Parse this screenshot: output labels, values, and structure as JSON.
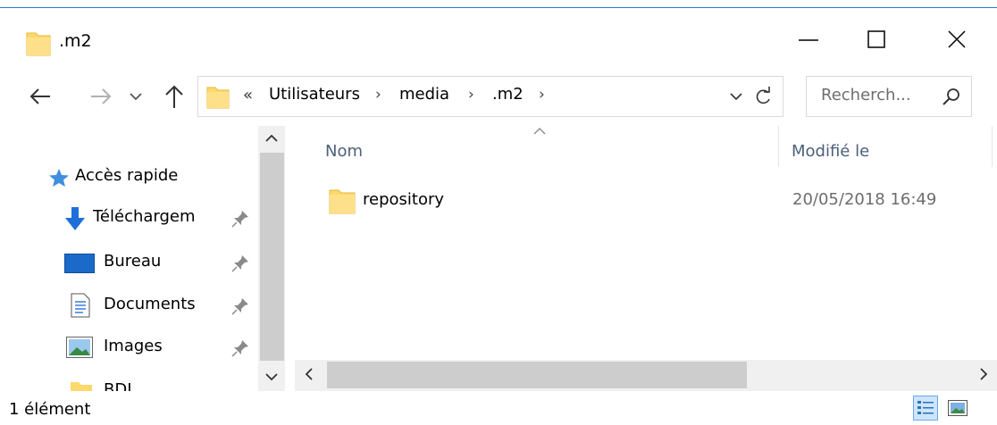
{
  "window": {
    "title": ".m2",
    "minimize_glyph": "—",
    "maximize_glyph": "☐",
    "close_glyph": "✕"
  },
  "address": {
    "overflow": "«",
    "crumbs": [
      "Utilisateurs",
      "media",
      ".m2"
    ],
    "separator": "›"
  },
  "search": {
    "placeholder": "Recherch..."
  },
  "nav_pane": {
    "items": [
      {
        "label": "Accès rapide",
        "icon": "star-icon"
      },
      {
        "label": "Téléchargem",
        "icon": "download-arrow-icon",
        "pinned": true
      },
      {
        "label": "Bureau",
        "icon": "desktop-icon",
        "pinned": true
      },
      {
        "label": "Documents",
        "icon": "document-icon",
        "pinned": true
      },
      {
        "label": "Images",
        "icon": "picture-icon",
        "pinned": true
      },
      {
        "label": "BDI",
        "icon": "folder-icon"
      }
    ]
  },
  "list": {
    "columns": {
      "name": "Nom",
      "modified": "Modifié le"
    },
    "rows": [
      {
        "name": "repository",
        "modified": "20/05/2018 16:49",
        "icon": "folder-icon"
      }
    ]
  },
  "status": {
    "count": "1 élément"
  },
  "colors": {
    "accent": "#2b79d8",
    "folder": "#ffd86b",
    "pin_blue": "#1e90ff",
    "header_text": "#4c607a"
  }
}
